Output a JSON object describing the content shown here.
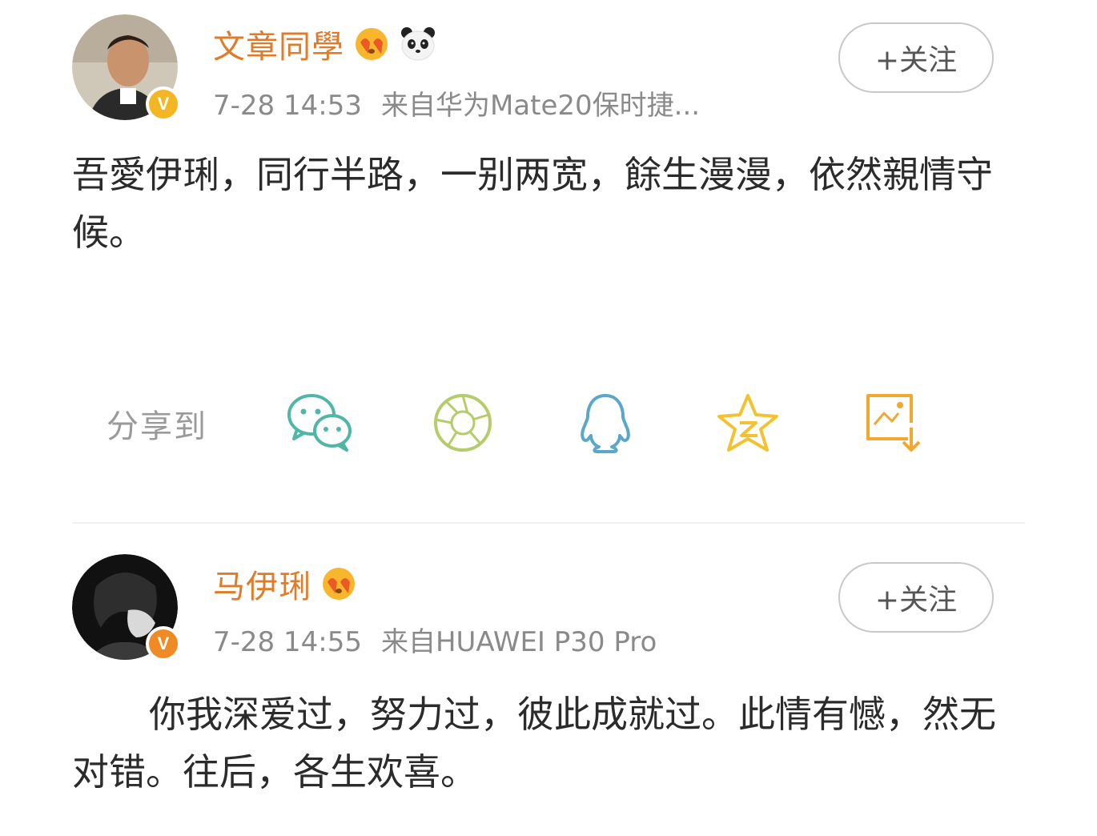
{
  "posts": [
    {
      "username": "文章同學",
      "time": "7-28 14:53",
      "source": "来自华为Mate20保时捷...",
      "follow_label": "+关注",
      "content": "吾愛伊琍，同行半路，一别两宽，餘生漫漫，依然親情守候。"
    },
    {
      "username": "马伊琍",
      "time": "7-28 14:55",
      "source": "来自HUAWEI P30 Pro",
      "follow_label": "+关注",
      "content": "你我深爱过，努力过，彼此成就过。此情有憾，然无对错。往后，各生欢喜。"
    }
  ],
  "share": {
    "label": "分享到",
    "icons": [
      "wechat-icon",
      "moments-icon",
      "qq-icon",
      "qzone-icon",
      "save-image-icon"
    ]
  },
  "colors": {
    "username": "#e07b2a",
    "meta": "#8a8a8a",
    "badge_gold": "#f5b623",
    "badge_orange": "#f08a24",
    "wechat": "#4fb6a8",
    "moments": "#b5cc6a",
    "qq": "#5aa7c8",
    "qzone": "#f2c230",
    "save": "#f0a830"
  }
}
